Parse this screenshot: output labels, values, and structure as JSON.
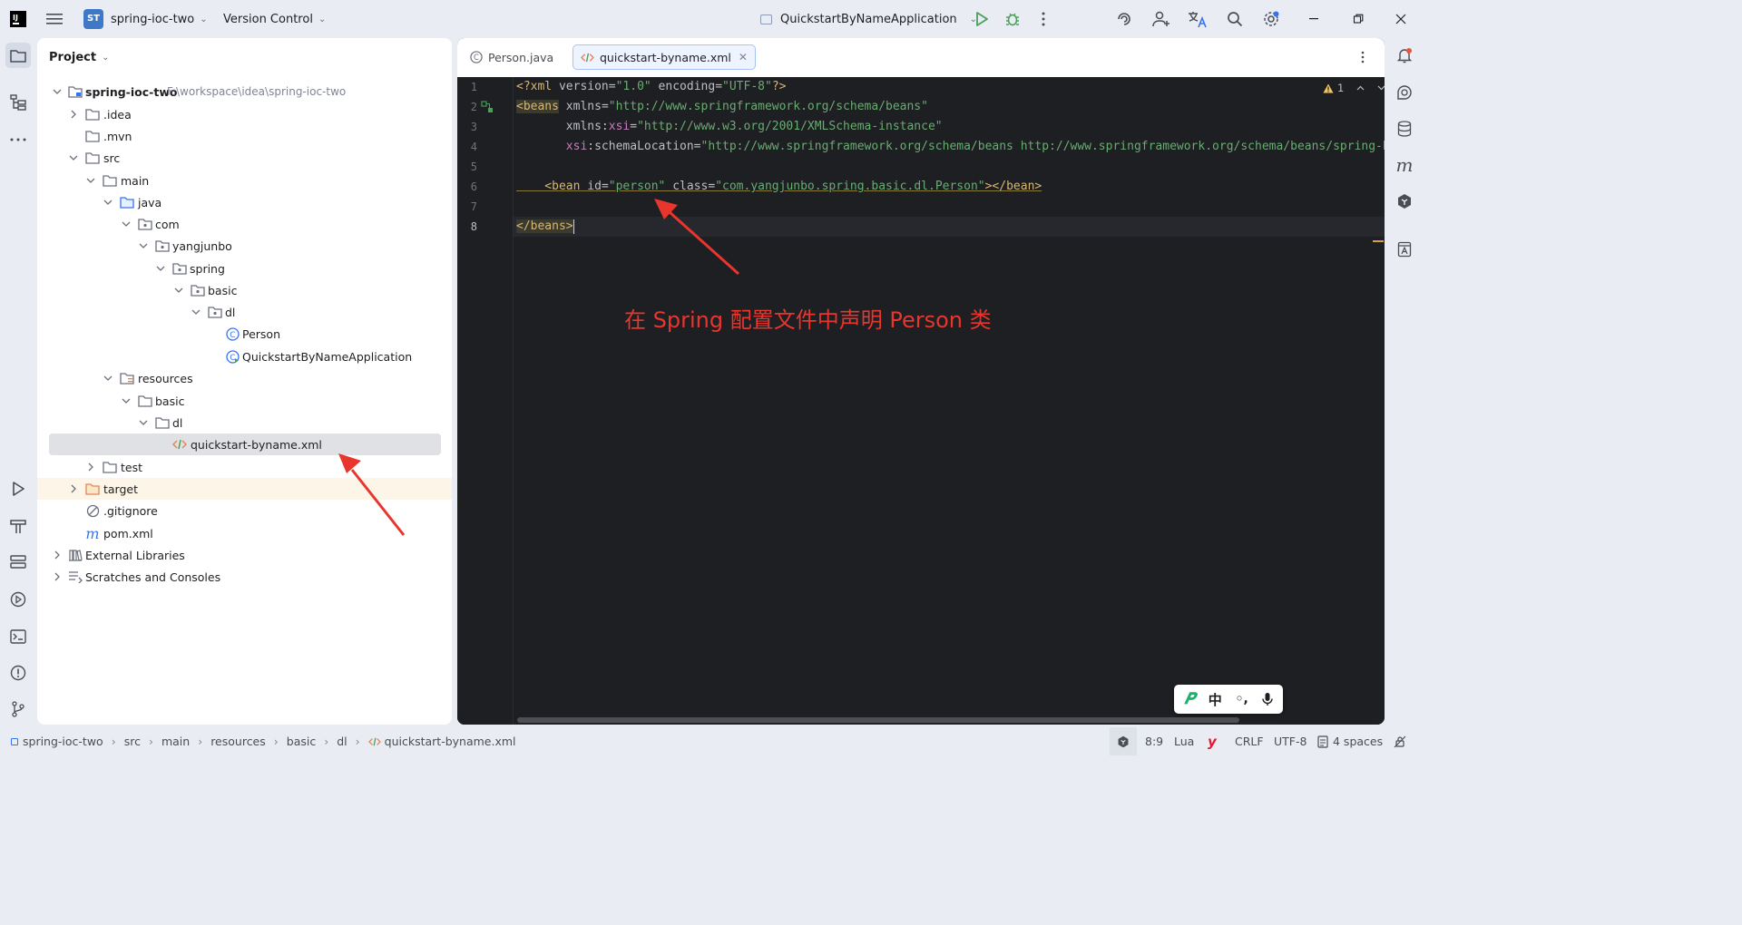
{
  "titlebar": {
    "project_badge": "ST",
    "project_name": "spring-ioc-two",
    "vcs": "Version Control",
    "run_config": "QuickstartByNameApplication"
  },
  "project_panel": {
    "title": "Project",
    "tree": [
      {
        "label": "spring-ioc-two",
        "extra": "F:\\workspace\\idea\\spring-ioc-two"
      },
      {
        "label": ".idea"
      },
      {
        "label": ".mvn"
      },
      {
        "label": "src"
      },
      {
        "label": "main"
      },
      {
        "label": "java"
      },
      {
        "label": "com"
      },
      {
        "label": "yangjunbo"
      },
      {
        "label": "spring"
      },
      {
        "label": "basic"
      },
      {
        "label": "dl"
      },
      {
        "label": "Person"
      },
      {
        "label": "QuickstartByNameApplication"
      },
      {
        "label": "resources"
      },
      {
        "label": "basic"
      },
      {
        "label": "dl"
      },
      {
        "label": "quickstart-byname.xml"
      },
      {
        "label": "test"
      },
      {
        "label": "target"
      },
      {
        "label": ".gitignore"
      },
      {
        "label": "pom.xml"
      },
      {
        "label": "External Libraries"
      },
      {
        "label": "Scratches and Consoles"
      }
    ]
  },
  "editor": {
    "tabs": [
      {
        "label": "Person.java"
      },
      {
        "label": "quickstart-byname.xml"
      }
    ],
    "warning_count": "1",
    "line_numbers": [
      "1",
      "2",
      "3",
      "4",
      "5",
      "6",
      "7",
      "8"
    ],
    "code": {
      "l1": {
        "a": "<?xml ",
        "b": "version",
        "c": "=",
        "d": "\"1.0\"",
        "e": " encoding",
        "f": "=",
        "g": "\"UTF-8\"",
        "h": "?>"
      },
      "l2": {
        "a": "<beans",
        "b": " xmlns",
        "c": "=",
        "d": "\"http://www.springframework.org/schema/beans\""
      },
      "l3": {
        "a": "       xmlns:",
        "b": "xsi",
        "c": "=",
        "d": "\"http://www.w3.org/2001/XMLSchema-instance\""
      },
      "l4": {
        "a": "       ",
        "b": "xsi",
        "c": ":schemaLocation=",
        "d": "\"http://www.springframework.org/schema/beans http://www.springframework.org/schema/beans/spring-beans.xsd\">"
      },
      "l6": {
        "a": "    <bean",
        "b": " id",
        "c": "=",
        "d": "\"person\"",
        "e": " class",
        "f": "=",
        "g": "\"com.yangjunbo.spring.basic.dl.Person\"",
        "h": "></bean>"
      },
      "l8": {
        "a": "</beans>"
      }
    }
  },
  "annotation": "在 Spring 配置文件中声明 Person 类",
  "ime": {
    "mode": "中",
    "punct": "◦,"
  },
  "statusbar": {
    "breadcrumb": [
      "spring-ioc-two",
      "src",
      "main",
      "resources",
      "basic",
      "dl",
      "quickstart-byname.xml"
    ],
    "position": "8:9",
    "lang": "Lua",
    "line_sep": "CRLF",
    "encoding": "UTF-8",
    "indent": "4 spaces"
  },
  "colors": {
    "accent": "#3574f0",
    "annotation": "#e8352d",
    "editor_bg": "#1e1f22"
  }
}
